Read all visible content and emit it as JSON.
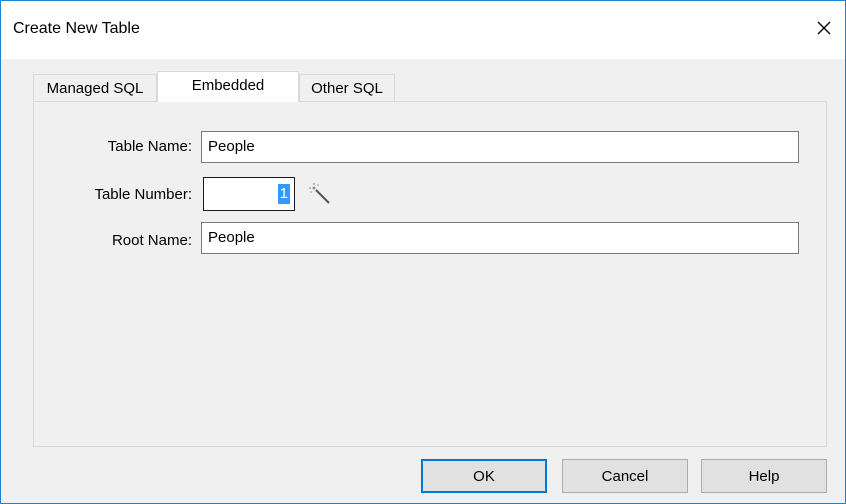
{
  "window": {
    "title": "Create New Table",
    "close_icon": "close-icon"
  },
  "tabs": [
    {
      "label": "Managed SQL",
      "active": false
    },
    {
      "label": "Embedded",
      "active": true
    },
    {
      "label": "Other SQL",
      "active": false
    }
  ],
  "form": {
    "table_name_label": "Table Name:",
    "table_name_value": "People",
    "table_number_label": "Table Number:",
    "table_number_value": "1",
    "table_number_tool_icon": "magic-wand-icon",
    "root_name_label": "Root Name:",
    "root_name_value": "People"
  },
  "buttons": {
    "ok": "OK",
    "cancel": "Cancel",
    "help": "Help"
  },
  "colors": {
    "accent": "#0078d7",
    "selection": "#3399ff"
  }
}
